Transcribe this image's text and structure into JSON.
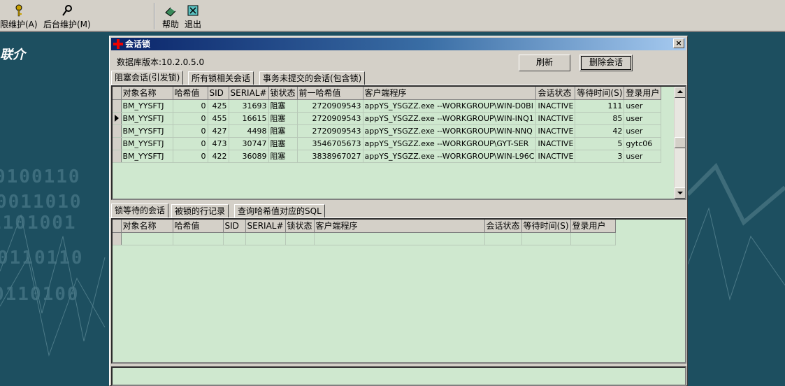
{
  "toolbar": {
    "items": [
      {
        "label": "限维护(A)",
        "icon": "key-icon"
      },
      {
        "label": "后台维护(M)",
        "icon": "wrench-icon"
      },
      {
        "label": "帮助",
        "icon": "book-icon"
      },
      {
        "label": "退出",
        "icon": "exit-icon"
      }
    ]
  },
  "background": {
    "logo": "联介",
    "bits": [
      "0100110",
      "0011010",
      "1101001",
      "0110110",
      "0110100"
    ]
  },
  "dialog": {
    "title": "会话锁",
    "close": "×",
    "db_version": "数据库版本:10.2.0.5.0",
    "refresh_label": "刷新",
    "delete_label": "删除会话",
    "top_tabs": [
      "阻塞会话(引发锁)",
      "所有锁相关会话",
      "事务未提交的会话(包含锁)"
    ],
    "top_grid": {
      "columns": [
        "对象名称",
        "哈希值",
        "SID",
        "SERIAL#",
        "锁状态",
        "前一哈希值",
        "客户端程序",
        "会话状态",
        "等待时间(S)",
        "登录用户"
      ],
      "rows": [
        [
          "BM_YYSFTJ",
          "0",
          "425",
          "31693",
          "阻塞",
          "2720909543",
          "appYS_YSGZZ.exe --WORKGROUP\\WIN-D0BI",
          "INACTIVE",
          "111",
          "user"
        ],
        [
          "BM_YYSFTJ",
          "0",
          "455",
          "16615",
          "阻塞",
          "2720909543",
          "appYS_YSGZZ.exe --WORKGROUP\\WIN-INQ1",
          "INACTIVE",
          "85",
          "user"
        ],
        [
          "BM_YYSFTJ",
          "0",
          "427",
          "4498",
          "阻塞",
          "2720909543",
          "appYS_YSGZZ.exe --WORKGROUP\\WIN-NNQ",
          "INACTIVE",
          "42",
          "user"
        ],
        [
          "BM_YYSFTJ",
          "0",
          "473",
          "30747",
          "阻塞",
          "3546705673",
          "appYS_YSGZZ.exe --WORKGROUP\\GYT-SER",
          "INACTIVE",
          "5",
          "gytc06"
        ],
        [
          "BM_YYSFTJ",
          "0",
          "422",
          "36089",
          "阻塞",
          "3838967027",
          "appYS_YSGZZ.exe --WORKGROUP\\WIN-L96C",
          "INACTIVE",
          "3",
          "user"
        ]
      ]
    },
    "bottom_tabs": [
      "锁等待的会话",
      "被锁的行记录",
      "查询哈希值对应的SQL"
    ],
    "bottom_grid": {
      "columns": [
        "对象名称",
        "哈希值",
        "SID",
        "SERIAL#",
        "锁状态",
        "客户端程序",
        "会话状态",
        "等待时间(S)",
        "登录用户"
      ]
    }
  }
}
